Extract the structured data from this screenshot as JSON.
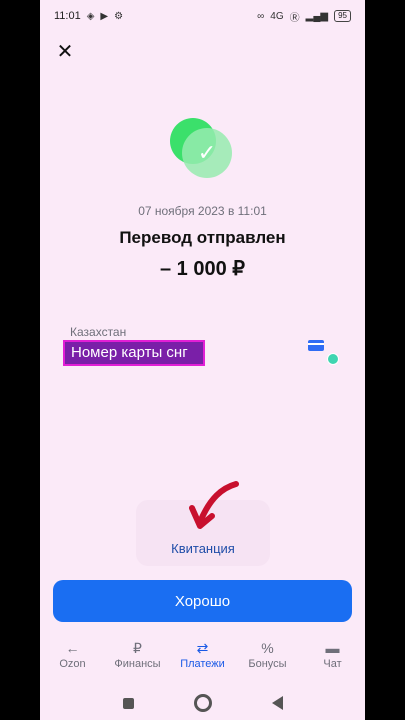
{
  "status": {
    "time": "11:01",
    "network": "4G",
    "battery": "95"
  },
  "receipt": {
    "date": "07 ноября 2023 в 11:01",
    "title": "Перевод отправлен",
    "amount": "– 1 000 ₽",
    "country": "Казахстан",
    "card": "Номер карты снг",
    "receipt_label": "Квитанция",
    "ok_label": "Хорошо"
  },
  "tabs": [
    {
      "label": "Ozon",
      "icon": "arrow-left-icon"
    },
    {
      "label": "Финансы",
      "icon": "ruble-coin-icon"
    },
    {
      "label": "Платежи",
      "icon": "transfer-arrows-icon",
      "active": true
    },
    {
      "label": "Бонусы",
      "icon": "percent-icon"
    },
    {
      "label": "Чат",
      "icon": "chat-bubble-icon"
    }
  ],
  "colors": {
    "background": "#fbeaf8",
    "accent": "#1a6ef2",
    "success": "#3be06b",
    "annotation": "#c8102e"
  }
}
